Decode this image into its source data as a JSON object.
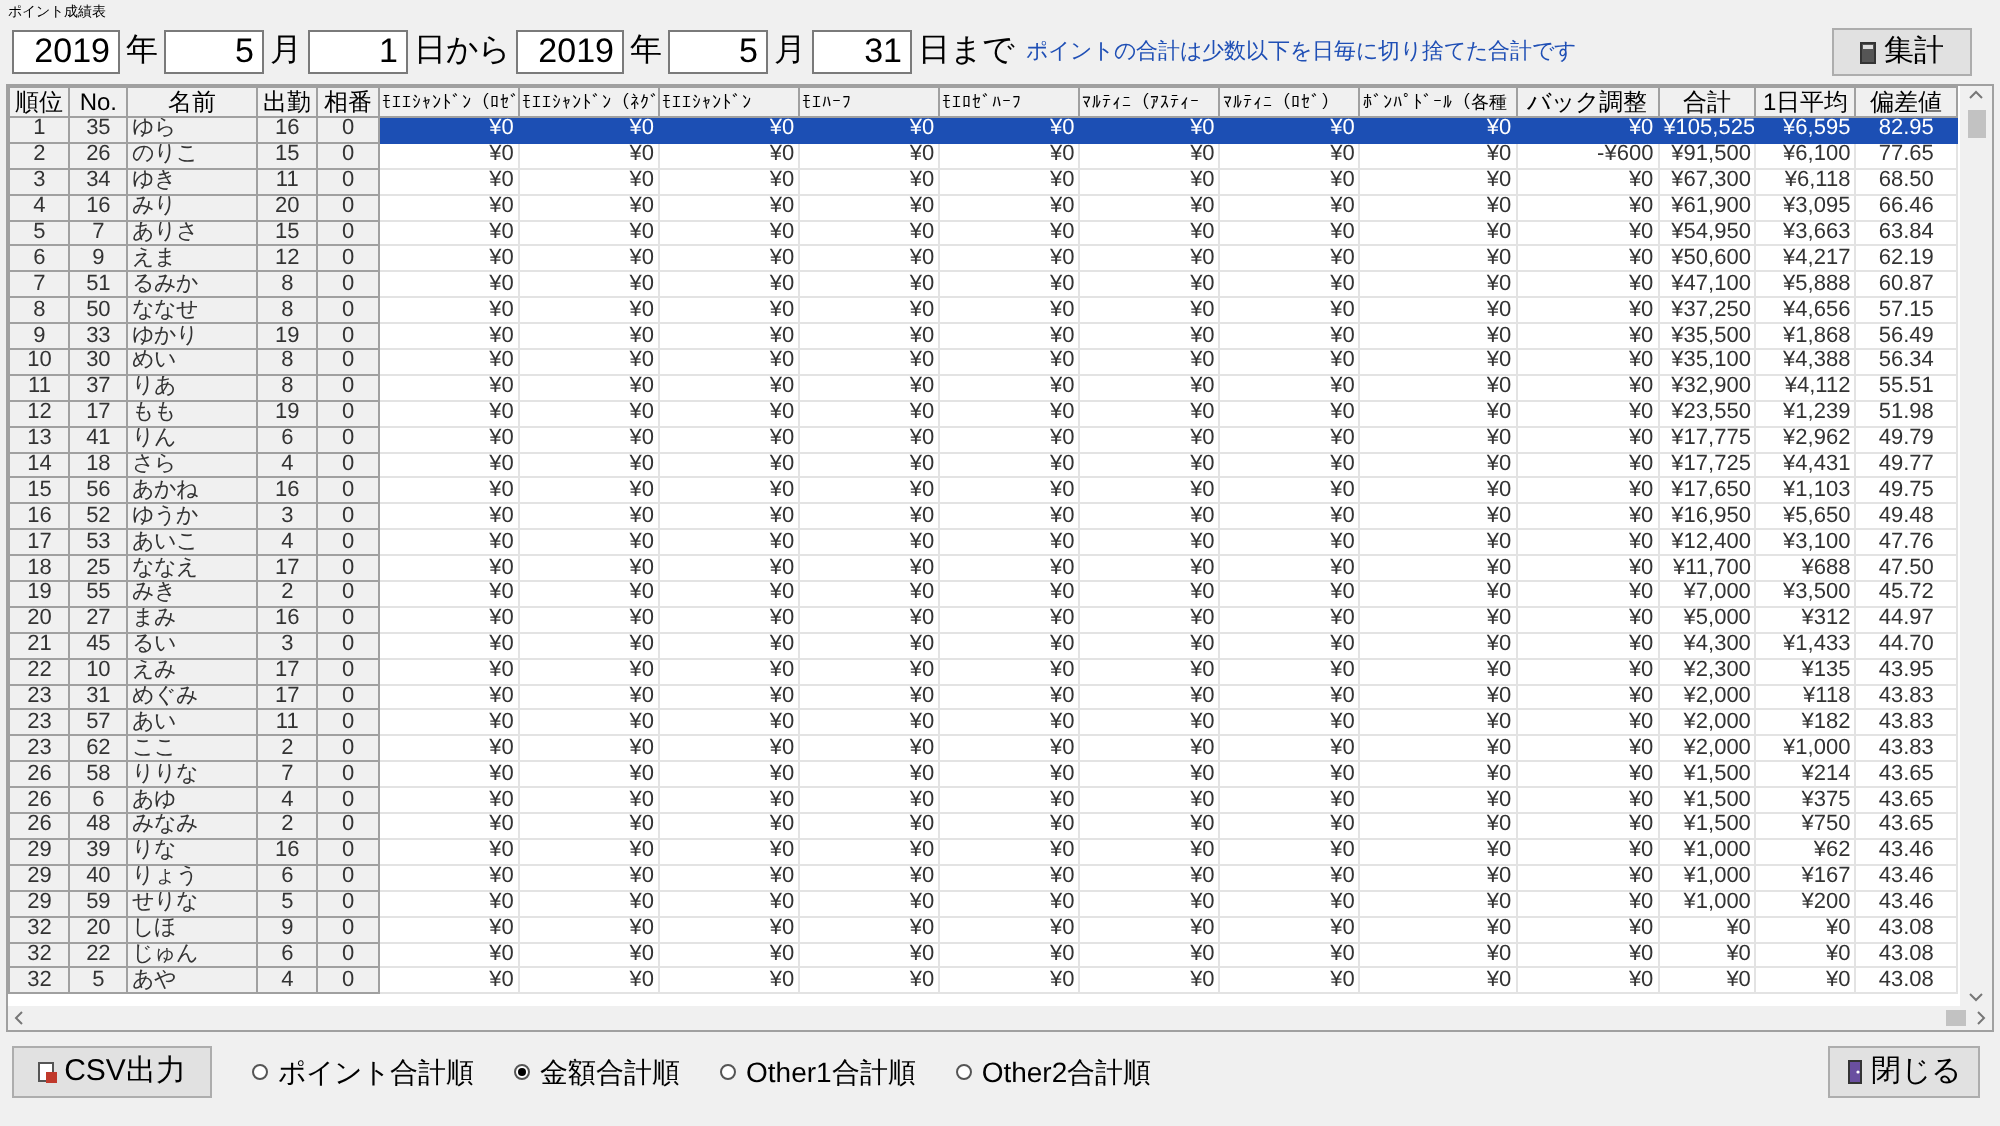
{
  "window": {
    "title": "ポイント成績表"
  },
  "date_fields": [
    {
      "value": "2019",
      "unit": "年"
    },
    {
      "value": "5",
      "unit": "月"
    },
    {
      "value": "1",
      "unit": "日から"
    },
    {
      "value": "2019",
      "unit": "年"
    },
    {
      "value": "5",
      "unit": "月"
    },
    {
      "value": "31",
      "unit": "日まで"
    }
  ],
  "note": "ポイントの合計は少数以下を日毎に切り捨てた合計です",
  "tally_button": "集計",
  "table": {
    "columns": [
      "順位",
      "No.",
      "名前",
      "出勤",
      "相番",
      "ﾓｴｴｼｬﾝﾄﾞﾝ（ﾛｾﾞ",
      "ﾓｴｴｼｬﾝﾄﾞﾝ（ﾈｸﾞ",
      "ﾓｴｴｼｬﾝﾄﾞﾝ",
      "ﾓｴﾊｰﾌ",
      "ﾓｴﾛｾﾞﾊｰﾌ",
      "ﾏﾙﾃｨﾆ（ｱｽﾃｨｰ",
      "ﾏﾙﾃｨﾆ（ﾛｾﾞ）",
      "ﾎﾞﾝﾊﾟﾄﾞｰﾙ（各種",
      "バック調整",
      "合計",
      "1日平均",
      "偏差値"
    ],
    "rows": [
      {
        "selected": true,
        "cells": [
          "1",
          "35",
          "ゆら",
          "16",
          "0",
          "¥0",
          "¥0",
          "¥0",
          "¥0",
          "¥0",
          "¥0",
          "¥0",
          "¥0",
          "¥0",
          "¥105,525",
          "¥6,595",
          "82.95"
        ]
      },
      {
        "selected": false,
        "cells": [
          "2",
          "26",
          "のりこ",
          "15",
          "0",
          "¥0",
          "¥0",
          "¥0",
          "¥0",
          "¥0",
          "¥0",
          "¥0",
          "¥0",
          "-¥600",
          "¥91,500",
          "¥6,100",
          "77.65"
        ]
      },
      {
        "selected": false,
        "cells": [
          "3",
          "34",
          "ゆき",
          "11",
          "0",
          "¥0",
          "¥0",
          "¥0",
          "¥0",
          "¥0",
          "¥0",
          "¥0",
          "¥0",
          "¥0",
          "¥67,300",
          "¥6,118",
          "68.50"
        ]
      },
      {
        "selected": false,
        "cells": [
          "4",
          "16",
          "みり",
          "20",
          "0",
          "¥0",
          "¥0",
          "¥0",
          "¥0",
          "¥0",
          "¥0",
          "¥0",
          "¥0",
          "¥0",
          "¥61,900",
          "¥3,095",
          "66.46"
        ]
      },
      {
        "selected": false,
        "cells": [
          "5",
          "7",
          "ありさ",
          "15",
          "0",
          "¥0",
          "¥0",
          "¥0",
          "¥0",
          "¥0",
          "¥0",
          "¥0",
          "¥0",
          "¥0",
          "¥54,950",
          "¥3,663",
          "63.84"
        ]
      },
      {
        "selected": false,
        "cells": [
          "6",
          "9",
          "えま",
          "12",
          "0",
          "¥0",
          "¥0",
          "¥0",
          "¥0",
          "¥0",
          "¥0",
          "¥0",
          "¥0",
          "¥0",
          "¥50,600",
          "¥4,217",
          "62.19"
        ]
      },
      {
        "selected": false,
        "cells": [
          "7",
          "51",
          "るみか",
          "8",
          "0",
          "¥0",
          "¥0",
          "¥0",
          "¥0",
          "¥0",
          "¥0",
          "¥0",
          "¥0",
          "¥0",
          "¥47,100",
          "¥5,888",
          "60.87"
        ]
      },
      {
        "selected": false,
        "cells": [
          "8",
          "50",
          "ななせ",
          "8",
          "0",
          "¥0",
          "¥0",
          "¥0",
          "¥0",
          "¥0",
          "¥0",
          "¥0",
          "¥0",
          "¥0",
          "¥37,250",
          "¥4,656",
          "57.15"
        ]
      },
      {
        "selected": false,
        "cells": [
          "9",
          "33",
          "ゆかり",
          "19",
          "0",
          "¥0",
          "¥0",
          "¥0",
          "¥0",
          "¥0",
          "¥0",
          "¥0",
          "¥0",
          "¥0",
          "¥35,500",
          "¥1,868",
          "56.49"
        ]
      },
      {
        "selected": false,
        "cells": [
          "10",
          "30",
          "めい",
          "8",
          "0",
          "¥0",
          "¥0",
          "¥0",
          "¥0",
          "¥0",
          "¥0",
          "¥0",
          "¥0",
          "¥0",
          "¥35,100",
          "¥4,388",
          "56.34"
        ]
      },
      {
        "selected": false,
        "cells": [
          "11",
          "37",
          "りあ",
          "8",
          "0",
          "¥0",
          "¥0",
          "¥0",
          "¥0",
          "¥0",
          "¥0",
          "¥0",
          "¥0",
          "¥0",
          "¥32,900",
          "¥4,112",
          "55.51"
        ]
      },
      {
        "selected": false,
        "cells": [
          "12",
          "17",
          "もも",
          "19",
          "0",
          "¥0",
          "¥0",
          "¥0",
          "¥0",
          "¥0",
          "¥0",
          "¥0",
          "¥0",
          "¥0",
          "¥23,550",
          "¥1,239",
          "51.98"
        ]
      },
      {
        "selected": false,
        "cells": [
          "13",
          "41",
          "りん",
          "6",
          "0",
          "¥0",
          "¥0",
          "¥0",
          "¥0",
          "¥0",
          "¥0",
          "¥0",
          "¥0",
          "¥0",
          "¥17,775",
          "¥2,962",
          "49.79"
        ]
      },
      {
        "selected": false,
        "cells": [
          "14",
          "18",
          "さら",
          "4",
          "0",
          "¥0",
          "¥0",
          "¥0",
          "¥0",
          "¥0",
          "¥0",
          "¥0",
          "¥0",
          "¥0",
          "¥17,725",
          "¥4,431",
          "49.77"
        ]
      },
      {
        "selected": false,
        "cells": [
          "15",
          "56",
          "あかね",
          "16",
          "0",
          "¥0",
          "¥0",
          "¥0",
          "¥0",
          "¥0",
          "¥0",
          "¥0",
          "¥0",
          "¥0",
          "¥17,650",
          "¥1,103",
          "49.75"
        ]
      },
      {
        "selected": false,
        "cells": [
          "16",
          "52",
          "ゆうか",
          "3",
          "0",
          "¥0",
          "¥0",
          "¥0",
          "¥0",
          "¥0",
          "¥0",
          "¥0",
          "¥0",
          "¥0",
          "¥16,950",
          "¥5,650",
          "49.48"
        ]
      },
      {
        "selected": false,
        "cells": [
          "17",
          "53",
          "あいこ",
          "4",
          "0",
          "¥0",
          "¥0",
          "¥0",
          "¥0",
          "¥0",
          "¥0",
          "¥0",
          "¥0",
          "¥0",
          "¥12,400",
          "¥3,100",
          "47.76"
        ]
      },
      {
        "selected": false,
        "cells": [
          "18",
          "25",
          "ななえ",
          "17",
          "0",
          "¥0",
          "¥0",
          "¥0",
          "¥0",
          "¥0",
          "¥0",
          "¥0",
          "¥0",
          "¥0",
          "¥11,700",
          "¥688",
          "47.50"
        ]
      },
      {
        "selected": false,
        "cells": [
          "19",
          "55",
          "みき",
          "2",
          "0",
          "¥0",
          "¥0",
          "¥0",
          "¥0",
          "¥0",
          "¥0",
          "¥0",
          "¥0",
          "¥0",
          "¥7,000",
          "¥3,500",
          "45.72"
        ]
      },
      {
        "selected": false,
        "cells": [
          "20",
          "27",
          "まみ",
          "16",
          "0",
          "¥0",
          "¥0",
          "¥0",
          "¥0",
          "¥0",
          "¥0",
          "¥0",
          "¥0",
          "¥0",
          "¥5,000",
          "¥312",
          "44.97"
        ]
      },
      {
        "selected": false,
        "cells": [
          "21",
          "45",
          "るい",
          "3",
          "0",
          "¥0",
          "¥0",
          "¥0",
          "¥0",
          "¥0",
          "¥0",
          "¥0",
          "¥0",
          "¥0",
          "¥4,300",
          "¥1,433",
          "44.70"
        ]
      },
      {
        "selected": false,
        "cells": [
          "22",
          "10",
          "えみ",
          "17",
          "0",
          "¥0",
          "¥0",
          "¥0",
          "¥0",
          "¥0",
          "¥0",
          "¥0",
          "¥0",
          "¥0",
          "¥2,300",
          "¥135",
          "43.95"
        ]
      },
      {
        "selected": false,
        "cells": [
          "23",
          "31",
          "めぐみ",
          "17",
          "0",
          "¥0",
          "¥0",
          "¥0",
          "¥0",
          "¥0",
          "¥0",
          "¥0",
          "¥0",
          "¥0",
          "¥2,000",
          "¥118",
          "43.83"
        ]
      },
      {
        "selected": false,
        "cells": [
          "23",
          "57",
          "あい",
          "11",
          "0",
          "¥0",
          "¥0",
          "¥0",
          "¥0",
          "¥0",
          "¥0",
          "¥0",
          "¥0",
          "¥0",
          "¥2,000",
          "¥182",
          "43.83"
        ]
      },
      {
        "selected": false,
        "cells": [
          "23",
          "62",
          "ここ",
          "2",
          "0",
          "¥0",
          "¥0",
          "¥0",
          "¥0",
          "¥0",
          "¥0",
          "¥0",
          "¥0",
          "¥0",
          "¥2,000",
          "¥1,000",
          "43.83"
        ]
      },
      {
        "selected": false,
        "cells": [
          "26",
          "58",
          "りりな",
          "7",
          "0",
          "¥0",
          "¥0",
          "¥0",
          "¥0",
          "¥0",
          "¥0",
          "¥0",
          "¥0",
          "¥0",
          "¥1,500",
          "¥214",
          "43.65"
        ]
      },
      {
        "selected": false,
        "cells": [
          "26",
          "6",
          "あゆ",
          "4",
          "0",
          "¥0",
          "¥0",
          "¥0",
          "¥0",
          "¥0",
          "¥0",
          "¥0",
          "¥0",
          "¥0",
          "¥1,500",
          "¥375",
          "43.65"
        ]
      },
      {
        "selected": false,
        "cells": [
          "26",
          "48",
          "みなみ",
          "2",
          "0",
          "¥0",
          "¥0",
          "¥0",
          "¥0",
          "¥0",
          "¥0",
          "¥0",
          "¥0",
          "¥0",
          "¥1,500",
          "¥750",
          "43.65"
        ]
      },
      {
        "selected": false,
        "cells": [
          "29",
          "39",
          "りな",
          "16",
          "0",
          "¥0",
          "¥0",
          "¥0",
          "¥0",
          "¥0",
          "¥0",
          "¥0",
          "¥0",
          "¥0",
          "¥1,000",
          "¥62",
          "43.46"
        ]
      },
      {
        "selected": false,
        "cells": [
          "29",
          "40",
          "りょう",
          "6",
          "0",
          "¥0",
          "¥0",
          "¥0",
          "¥0",
          "¥0",
          "¥0",
          "¥0",
          "¥0",
          "¥0",
          "¥1,000",
          "¥167",
          "43.46"
        ]
      },
      {
        "selected": false,
        "cells": [
          "29",
          "59",
          "せりな",
          "5",
          "0",
          "¥0",
          "¥0",
          "¥0",
          "¥0",
          "¥0",
          "¥0",
          "¥0",
          "¥0",
          "¥0",
          "¥1,000",
          "¥200",
          "43.46"
        ]
      },
      {
        "selected": false,
        "cells": [
          "32",
          "20",
          "しほ",
          "9",
          "0",
          "¥0",
          "¥0",
          "¥0",
          "¥0",
          "¥0",
          "¥0",
          "¥0",
          "¥0",
          "¥0",
          "¥0",
          "¥0",
          "43.08"
        ]
      },
      {
        "selected": false,
        "cells": [
          "32",
          "22",
          "じゅん",
          "6",
          "0",
          "¥0",
          "¥0",
          "¥0",
          "¥0",
          "¥0",
          "¥0",
          "¥0",
          "¥0",
          "¥0",
          "¥0",
          "¥0",
          "43.08"
        ]
      },
      {
        "selected": false,
        "cells": [
          "32",
          "5",
          "あや",
          "4",
          "0",
          "¥0",
          "¥0",
          "¥0",
          "¥0",
          "¥0",
          "¥0",
          "¥0",
          "¥0",
          "¥0",
          "¥0",
          "¥0",
          "43.08"
        ]
      }
    ]
  },
  "csv_button": "CSV出力",
  "sort_options": [
    {
      "label": "ポイント合計順",
      "selected": false
    },
    {
      "label": "金額合計順",
      "selected": true
    },
    {
      "label": "Other1合計順",
      "selected": false
    },
    {
      "label": "Other2合計順",
      "selected": false
    }
  ],
  "close_button": "閉じる"
}
